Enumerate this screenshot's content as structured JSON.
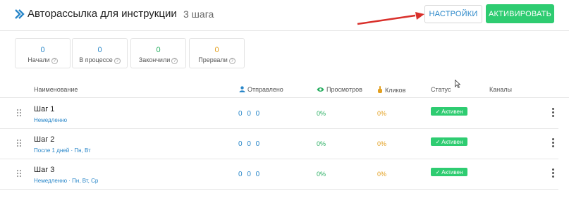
{
  "header": {
    "title": "Авторассылка для инструкции",
    "steps_count": "3 шага",
    "settings_label": "НАСТРОЙКИ",
    "activate_label": "АКТИВИРОВАТЬ"
  },
  "stats": [
    {
      "value": "0",
      "label": "Начали",
      "color": "#2a87c9"
    },
    {
      "value": "0",
      "label": "В процессе",
      "color": "#2a87c9"
    },
    {
      "value": "0",
      "label": "Закончили",
      "color": "#27ae60"
    },
    {
      "value": "0",
      "label": "Прервали",
      "color": "#e3a020"
    }
  ],
  "table": {
    "columns": {
      "name": "Наименование",
      "sent": "Отправлено",
      "views": "Просмотров",
      "clicks": "Кликов",
      "status": "Статус",
      "channels": "Каналы"
    },
    "rows": [
      {
        "name": "Шаг 1",
        "delay": "Немедленно",
        "sent": "0 0 0",
        "views": "0%",
        "clicks": "0%",
        "status": "Активен"
      },
      {
        "name": "Шаг 2",
        "delay": "После 1 дней · Пн, Вт",
        "sent": "0 0 0",
        "views": "0%",
        "clicks": "0%",
        "status": "Активен"
      },
      {
        "name": "Шаг 3",
        "delay": "Немедленно · Пн, Вт, Ср",
        "sent": "0 0 0",
        "views": "0%",
        "clicks": "0%",
        "status": "Активен"
      }
    ]
  },
  "colors": {
    "accent_blue": "#2a87c9",
    "success_green": "#2ecc71",
    "annotation_red": "#d9302b"
  },
  "icons": [
    "double-chevron-logo-icon",
    "help-circle-icon",
    "person-icon",
    "eye-icon",
    "click-hand-icon",
    "drag-handle-icon",
    "check-icon",
    "more-vertical-icon"
  ]
}
